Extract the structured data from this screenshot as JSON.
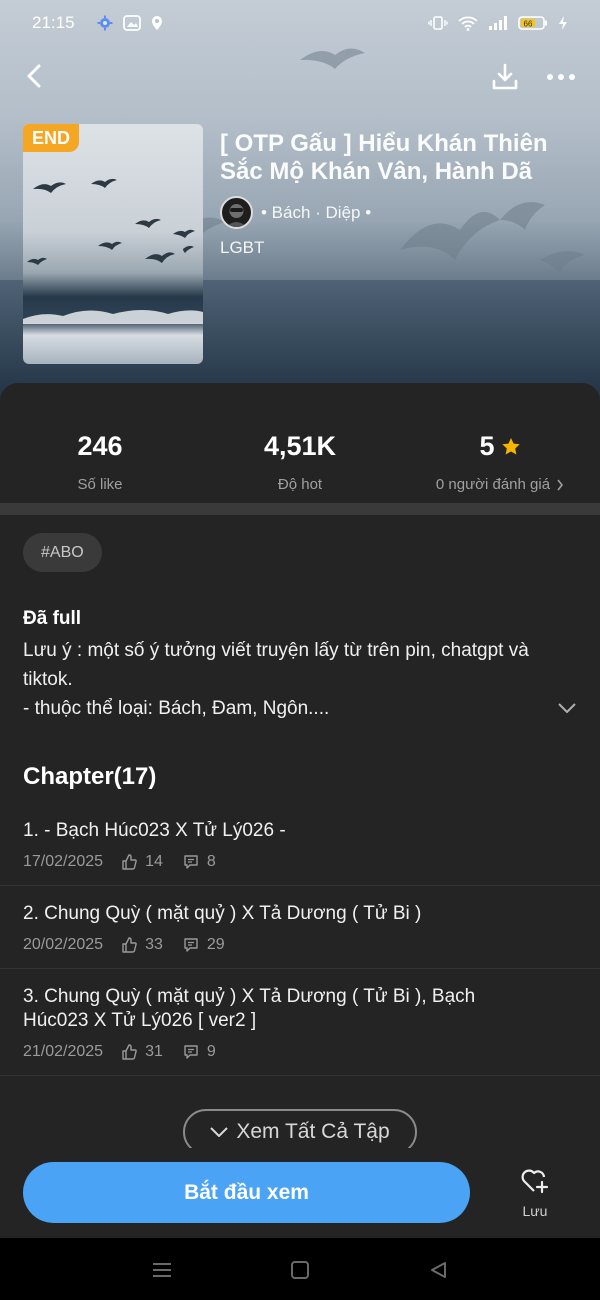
{
  "status_bar": {
    "time": "21:15",
    "battery": "66",
    "icons": [
      "gear-icon",
      "image-icon",
      "location-icon",
      "vibrate-icon",
      "wifi-icon",
      "signal-icon",
      "battery-icon",
      "charging-icon"
    ]
  },
  "header": {
    "badge": "END",
    "title": "[ OTP Gấu ] Hiểu Khán Thiên Sắc Mộ Khán Vân, Hành Dã",
    "author": "• Bách · Diệp •",
    "genre": "LGBT",
    "icons": [
      "back-arrow-icon",
      "download-icon",
      "more-dots-icon"
    ]
  },
  "stats": [
    {
      "value": "246",
      "label": "Số like"
    },
    {
      "value": "4,51K",
      "label": "Độ hot"
    },
    {
      "value": "5",
      "label": "0 người đánh giá"
    }
  ],
  "tags": [
    "#ABO"
  ],
  "description": {
    "heading": "Đã full",
    "lines": [
      "Lưu ý : một số ý tưởng viết truyện lấy từ trên pin, chatgpt và",
      "tiktok.",
      "- thuộc thể loại: Bách, Đam, Ngôn...."
    ]
  },
  "chapters": {
    "heading": "Chapter(17)",
    "items": [
      {
        "title": "1. - Bạch Húc023 X Tử Lý026 -",
        "date": "17/02/2025",
        "likes": "14",
        "comments": "8"
      },
      {
        "title": "2. Chung Quỳ ( mặt quỷ ) X Tả Dương ( Tử Bi )",
        "date": "20/02/2025",
        "likes": "33",
        "comments": "29"
      },
      {
        "title": "3. Chung Quỳ ( mặt quỷ ) X Tả Dương ( Tử Bi ), Bạch Húc023 X Tử Lý026 [ ver2 ]",
        "date": "21/02/2025",
        "likes": "31",
        "comments": "9"
      }
    ],
    "view_all": "Xem Tất Cả Tập"
  },
  "actions": {
    "start": "Bắt đầu xem",
    "save": "Lưu"
  },
  "colors": {
    "accent": "#4aa3f5",
    "badge": "#f5a623",
    "star": "#f5b400",
    "panel": "#242424"
  }
}
